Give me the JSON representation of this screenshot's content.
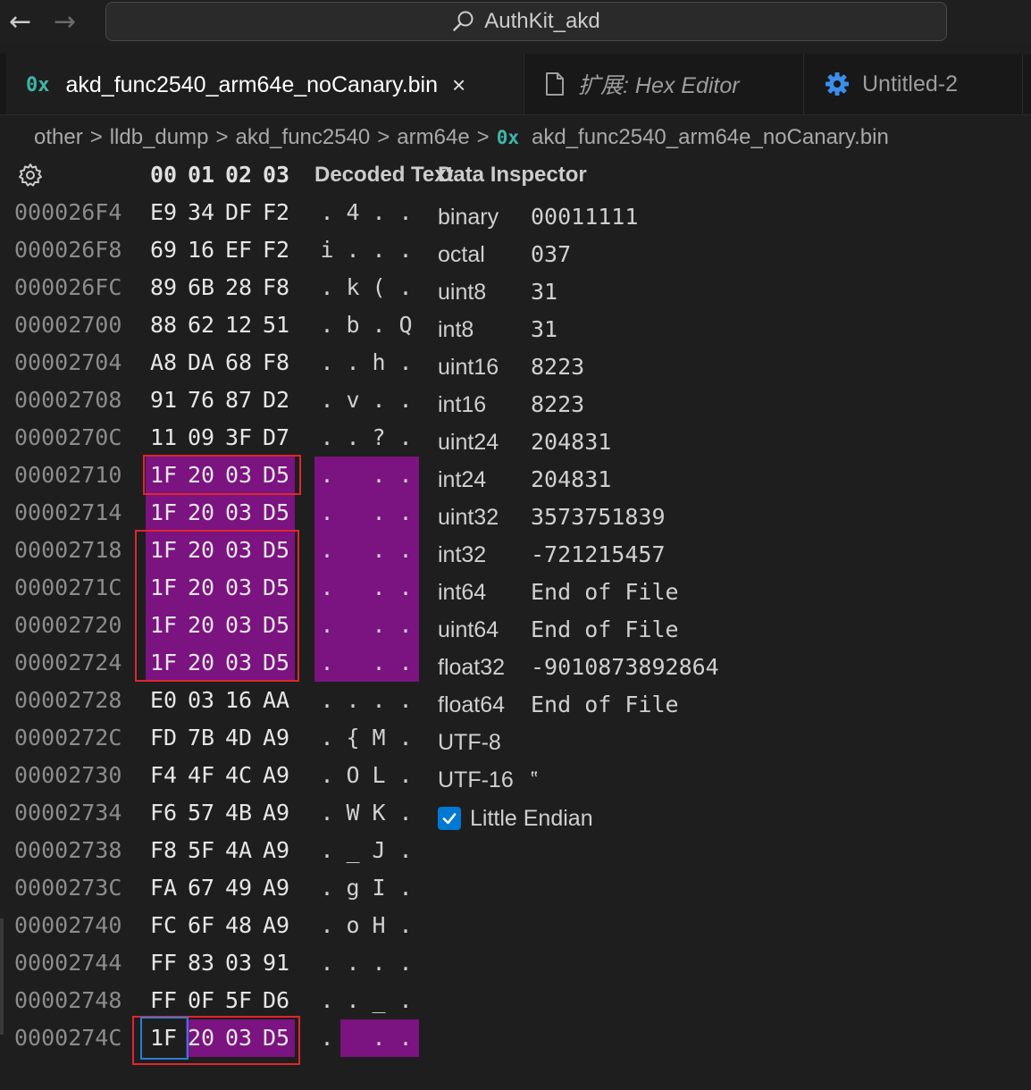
{
  "titlebar": {
    "back_icon": "arrow-left-icon",
    "forward_icon": "arrow-right-icon",
    "search_icon": "search-icon",
    "search_text": "AuthKit_akd"
  },
  "tabs": [
    {
      "icon": "0x",
      "label": "akd_func2540_arm64e_noCanary.bin",
      "close": "×",
      "active": true
    },
    {
      "icon": "file-icon",
      "label": "扩展: Hex Editor",
      "active": false
    },
    {
      "icon": "gear-icon",
      "label": "Untitled-2",
      "active": false
    }
  ],
  "breadcrumb": {
    "items": [
      "other",
      "lldb_dump",
      "akd_func2540",
      "arm64e"
    ],
    "separator": ">",
    "file_icon": "0x",
    "file": "akd_func2540_arm64e_noCanary.bin"
  },
  "hex": {
    "settings_icon": "gear-icon",
    "header_bytes": [
      "00",
      "01",
      "02",
      "03"
    ],
    "decoded_header": "Decoded Text",
    "rows": [
      {
        "addr": "000026F4",
        "bytes": [
          "E9",
          "34",
          "DF",
          "F2"
        ],
        "text": [
          ".",
          "4",
          ".",
          "."
        ],
        "hl": false
      },
      {
        "addr": "000026F8",
        "bytes": [
          "69",
          "16",
          "EF",
          "F2"
        ],
        "text": [
          "i",
          ".",
          ".",
          "."
        ],
        "hl": false
      },
      {
        "addr": "000026FC",
        "bytes": [
          "89",
          "6B",
          "28",
          "F8"
        ],
        "text": [
          ".",
          "k",
          "(",
          "."
        ],
        "hl": false
      },
      {
        "addr": "00002700",
        "bytes": [
          "88",
          "62",
          "12",
          "51"
        ],
        "text": [
          ".",
          "b",
          ".",
          "Q"
        ],
        "hl": false
      },
      {
        "addr": "00002704",
        "bytes": [
          "A8",
          "DA",
          "68",
          "F8"
        ],
        "text": [
          ".",
          ".",
          "h",
          "."
        ],
        "hl": false
      },
      {
        "addr": "00002708",
        "bytes": [
          "91",
          "76",
          "87",
          "D2"
        ],
        "text": [
          ".",
          "v",
          ".",
          "."
        ],
        "hl": false
      },
      {
        "addr": "0000270C",
        "bytes": [
          "11",
          "09",
          "3F",
          "D7"
        ],
        "text": [
          ".",
          ".",
          "?",
          "."
        ],
        "hl": false
      },
      {
        "addr": "00002710",
        "bytes": [
          "1F",
          "20",
          "03",
          "D5"
        ],
        "text": [
          ".",
          "",
          ".",
          "."
        ],
        "hl": true
      },
      {
        "addr": "00002714",
        "bytes": [
          "1F",
          "20",
          "03",
          "D5"
        ],
        "text": [
          ".",
          "",
          ".",
          "."
        ],
        "hl": true
      },
      {
        "addr": "00002718",
        "bytes": [
          "1F",
          "20",
          "03",
          "D5"
        ],
        "text": [
          ".",
          "",
          ".",
          "."
        ],
        "hl": true
      },
      {
        "addr": "0000271C",
        "bytes": [
          "1F",
          "20",
          "03",
          "D5"
        ],
        "text": [
          ".",
          "",
          ".",
          "."
        ],
        "hl": true
      },
      {
        "addr": "00002720",
        "bytes": [
          "1F",
          "20",
          "03",
          "D5"
        ],
        "text": [
          ".",
          "",
          ".",
          "."
        ],
        "hl": true
      },
      {
        "addr": "00002724",
        "bytes": [
          "1F",
          "20",
          "03",
          "D5"
        ],
        "text": [
          ".",
          "",
          ".",
          "."
        ],
        "hl": true
      },
      {
        "addr": "00002728",
        "bytes": [
          "E0",
          "03",
          "16",
          "AA"
        ],
        "text": [
          ".",
          ".",
          ".",
          "."
        ],
        "hl": false
      },
      {
        "addr": "0000272C",
        "bytes": [
          "FD",
          "7B",
          "4D",
          "A9"
        ],
        "text": [
          ".",
          "{",
          "M",
          "."
        ],
        "hl": false
      },
      {
        "addr": "00002730",
        "bytes": [
          "F4",
          "4F",
          "4C",
          "A9"
        ],
        "text": [
          ".",
          "O",
          "L",
          "."
        ],
        "hl": false
      },
      {
        "addr": "00002734",
        "bytes": [
          "F6",
          "57",
          "4B",
          "A9"
        ],
        "text": [
          ".",
          "W",
          "K",
          "."
        ],
        "hl": false
      },
      {
        "addr": "00002738",
        "bytes": [
          "F8",
          "5F",
          "4A",
          "A9"
        ],
        "text": [
          ".",
          "_",
          "J",
          "."
        ],
        "hl": false
      },
      {
        "addr": "0000273C",
        "bytes": [
          "FA",
          "67",
          "49",
          "A9"
        ],
        "text": [
          ".",
          "g",
          "I",
          "."
        ],
        "hl": false
      },
      {
        "addr": "00002740",
        "bytes": [
          "FC",
          "6F",
          "48",
          "A9"
        ],
        "text": [
          ".",
          "o",
          "H",
          "."
        ],
        "hl": false
      },
      {
        "addr": "00002744",
        "bytes": [
          "FF",
          "83",
          "03",
          "91"
        ],
        "text": [
          ".",
          ".",
          ".",
          "."
        ],
        "hl": false
      },
      {
        "addr": "00002748",
        "bytes": [
          "FF",
          "0F",
          "5F",
          "D6"
        ],
        "text": [
          ".",
          ".",
          "_",
          "."
        ],
        "hl": false
      },
      {
        "addr": "0000274C",
        "bytes": [
          "1F",
          "20",
          "03",
          "D5"
        ],
        "text": [
          ".",
          "",
          ".",
          "."
        ],
        "hl": "partial"
      }
    ]
  },
  "inspector": {
    "title": "Data Inspector",
    "fields": [
      {
        "label": "binary",
        "value": "00011111",
        "mono": true
      },
      {
        "label": "octal",
        "value": "037",
        "mono": true
      },
      {
        "label": "uint8",
        "value": "31",
        "mono": true
      },
      {
        "label": "int8",
        "value": "31",
        "mono": true
      },
      {
        "label": "uint16",
        "value": "8223",
        "mono": true
      },
      {
        "label": "int16",
        "value": "8223",
        "mono": true
      },
      {
        "label": "uint24",
        "value": "204831",
        "mono": true
      },
      {
        "label": "int24",
        "value": "204831",
        "mono": true
      },
      {
        "label": "uint32",
        "value": "3573751839",
        "mono": true
      },
      {
        "label": "int32",
        "value": "-721215457",
        "mono": true
      },
      {
        "label": "int64",
        "value": "End of File",
        "mono": true
      },
      {
        "label": "uint64",
        "value": "End of File",
        "mono": true
      },
      {
        "label": "float32",
        "value": "-9010873892864",
        "mono": true
      },
      {
        "label": "float64",
        "value": "End of File",
        "mono": true
      },
      {
        "label": "UTF-8",
        "value": "",
        "mono": false
      },
      {
        "label": "UTF-16",
        "value": "‟",
        "mono": false
      }
    ],
    "little_endian_label": "Little Endian",
    "little_endian_checked": true,
    "check_icon": "checkmark-icon"
  },
  "colors": {
    "highlight": "#7b1380",
    "selection_outline": "#e0262d",
    "cursor": "#2a7fd4",
    "bin_icon": "#3fb5a8"
  }
}
